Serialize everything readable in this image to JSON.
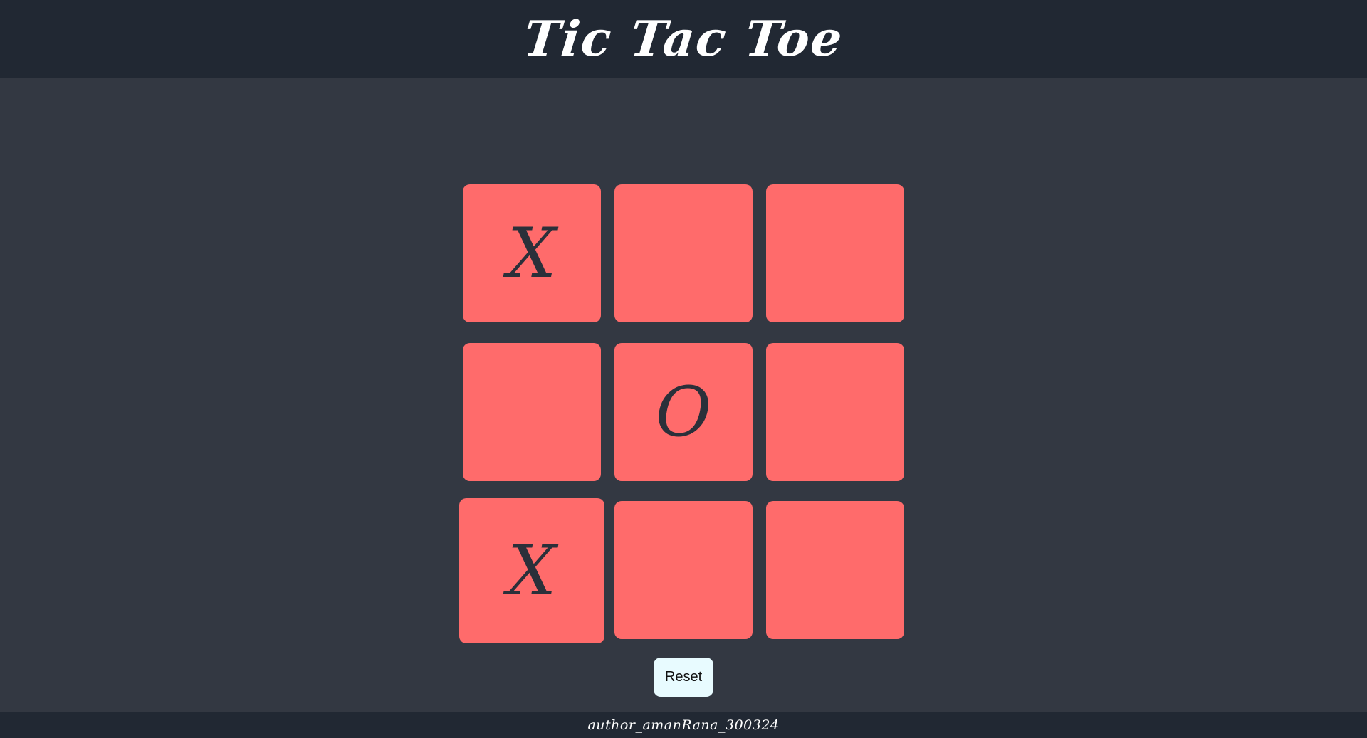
{
  "header": {
    "title": "Tic Tac Toe"
  },
  "board": {
    "cells": [
      {
        "value": "X"
      },
      {
        "value": ""
      },
      {
        "value": ""
      },
      {
        "value": ""
      },
      {
        "value": "O"
      },
      {
        "value": ""
      },
      {
        "value": "X"
      },
      {
        "value": ""
      },
      {
        "value": ""
      }
    ]
  },
  "controls": {
    "reset_label": "Reset"
  },
  "footer": {
    "author": "author_amanRana_300324"
  },
  "colors": {
    "header_bg": "#212833",
    "page_bg": "#333842",
    "cell_bg": "#ff6b6b",
    "mark_color": "#2b303a",
    "button_bg": "#e8fbff"
  }
}
